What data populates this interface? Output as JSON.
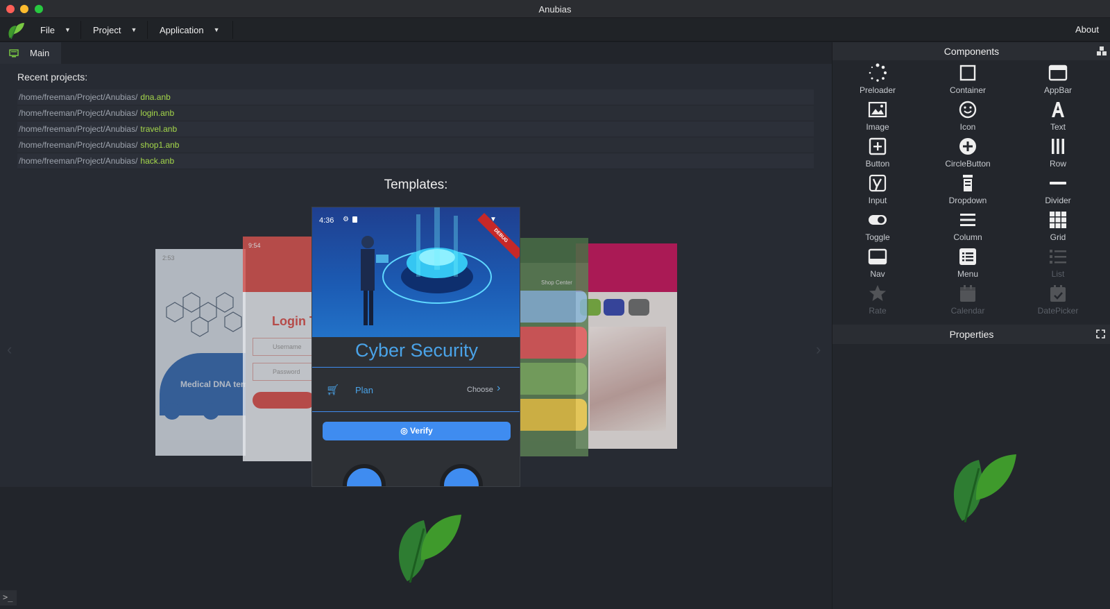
{
  "window": {
    "title": "Anubias"
  },
  "menubar": {
    "file": "File",
    "project": "Project",
    "application": "Application",
    "about": "About"
  },
  "tabs": [
    {
      "label": "Main"
    }
  ],
  "recent": {
    "heading": "Recent projects:",
    "items": [
      {
        "path": "/home/freeman/Project/Anubias/",
        "file": "dna.anb"
      },
      {
        "path": "/home/freeman/Project/Anubias/",
        "file": "login.anb"
      },
      {
        "path": "/home/freeman/Project/Anubias/",
        "file": "travel.anb"
      },
      {
        "path": "/home/freeman/Project/Anubias/",
        "file": "shop1.anb"
      },
      {
        "path": "/home/freeman/Project/Anubias/",
        "file": "hack.anb"
      }
    ]
  },
  "templates": {
    "heading": "Templates:",
    "center": {
      "time": "4:36",
      "badge": "DEBUG",
      "title": "Cyber Security",
      "plan_label": "Plan",
      "choose_label": "Choose",
      "verify_label": "Verify"
    },
    "dna": {
      "time": "2:53",
      "label": "Medical DNA template"
    },
    "login": {
      "time": "9:54",
      "title": "Login T",
      "username": "Username",
      "password": "Password"
    },
    "travel": {
      "label": "Shop Center"
    }
  },
  "components": {
    "heading": "Components",
    "items": [
      {
        "label": "Preloader",
        "icon": "preloader-icon"
      },
      {
        "label": "Container",
        "icon": "container-icon"
      },
      {
        "label": "AppBar",
        "icon": "appbar-icon"
      },
      {
        "label": "Image",
        "icon": "image-icon"
      },
      {
        "label": "Icon",
        "icon": "smiley-icon"
      },
      {
        "label": "Text",
        "icon": "text-icon"
      },
      {
        "label": "Button",
        "icon": "button-icon"
      },
      {
        "label": "CircleButton",
        "icon": "circle-plus-icon"
      },
      {
        "label": "Row",
        "icon": "row-icon"
      },
      {
        "label": "Input",
        "icon": "input-icon"
      },
      {
        "label": "Dropdown",
        "icon": "dropdown-icon"
      },
      {
        "label": "Divider",
        "icon": "divider-icon"
      },
      {
        "label": "Toggle",
        "icon": "toggle-icon"
      },
      {
        "label": "Column",
        "icon": "column-icon"
      },
      {
        "label": "Grid",
        "icon": "grid-icon"
      },
      {
        "label": "Nav",
        "icon": "nav-icon"
      },
      {
        "label": "Menu",
        "icon": "menu-icon"
      },
      {
        "label": "List",
        "icon": "list-icon"
      },
      {
        "label": "Rate",
        "icon": "star-icon"
      },
      {
        "label": "Calendar",
        "icon": "calendar-icon"
      },
      {
        "label": "DatePicker",
        "icon": "datepicker-icon"
      }
    ]
  },
  "properties": {
    "heading": "Properties"
  },
  "colors": {
    "accent_green": "#a5d84b",
    "brand_green": "#2e7d32",
    "primary_blue": "#3f8cf0",
    "cyber_title": "#4aa3e8"
  }
}
